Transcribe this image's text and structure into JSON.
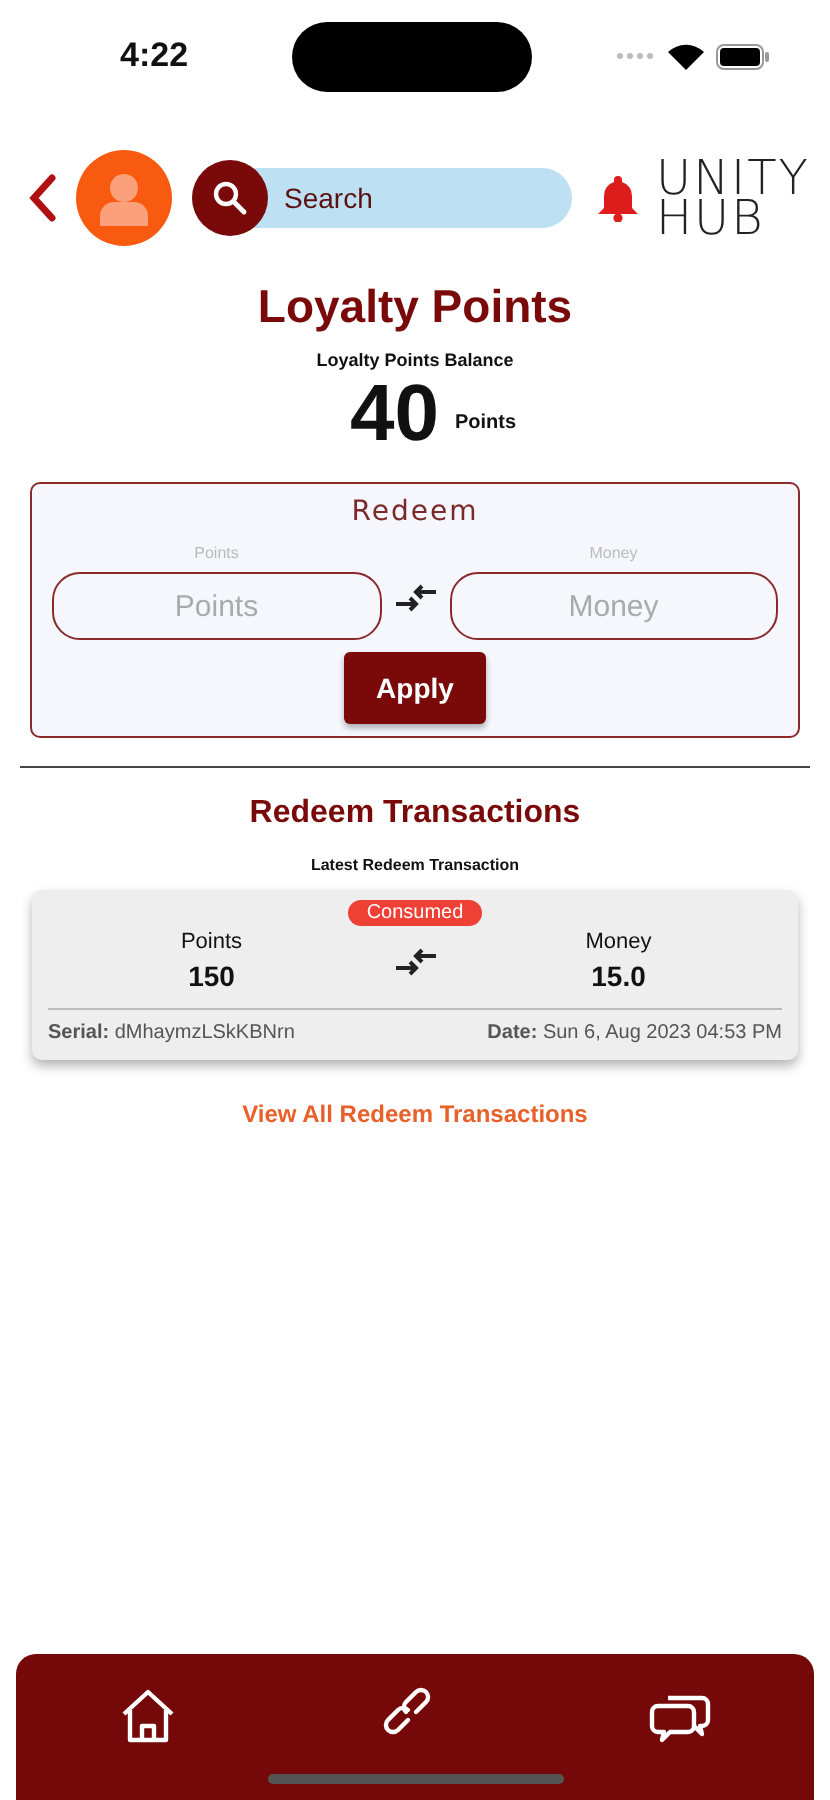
{
  "status_bar": {
    "time": "4:22"
  },
  "header": {
    "search": {
      "placeholder": "Search"
    },
    "logo": [
      "UNITY",
      "HUB"
    ]
  },
  "title": "Loyalty Points",
  "balance": {
    "label": "Loyalty Points Balance",
    "value": "40",
    "unit": "Points"
  },
  "redeem": {
    "title": "Redeem",
    "fields": [
      {
        "label": "Points",
        "placeholder": "Points"
      },
      {
        "label": "Money",
        "placeholder": "Money"
      }
    ],
    "button": "Apply"
  },
  "transactions": {
    "title": "Redeem Transactions",
    "subtitle": "Latest Redeem Transaction",
    "latest": {
      "status": "Consumed",
      "left_label": "Points",
      "left_value": "150",
      "right_label": "Money",
      "right_value": "15.0",
      "serial": "**Serial:** dMhaymzLSkKBNrn",
      "date": "**Date:** Sun 6, Aug 2023 04:53 PM"
    },
    "view_all": "View All Redeem Transactions"
  },
  "bottom_nav": [
    {
      "kind": "home"
    },
    {
      "kind": "link"
    },
    {
      "kind": "chat"
    }
  ]
}
